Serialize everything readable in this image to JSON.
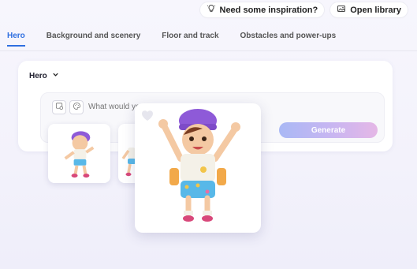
{
  "header": {
    "inspiration_label": "Need some inspiration?",
    "library_label": "Open library"
  },
  "tabs": [
    {
      "label": "Hero",
      "active": true
    },
    {
      "label": "Background and scenery",
      "active": false
    },
    {
      "label": "Floor and track",
      "active": false
    },
    {
      "label": "Obstacles and power-ups",
      "active": false
    }
  ],
  "panel": {
    "dropdown_value": "Hero",
    "prompt_placeholder": "What would you",
    "generate_label": "Generate"
  },
  "colors": {
    "accent": "#2f6fe0",
    "generate_gradient": [
      "#a9b8f5",
      "#c9b6f1",
      "#e5b7e6"
    ]
  },
  "icons": {
    "inspiration": "lightbulb-icon",
    "library": "image-library-icon",
    "dropdown": "chevron-down-icon",
    "tool_1": "image-settings-icon",
    "tool_2": "palette-icon",
    "favorite": "heart-icon"
  }
}
